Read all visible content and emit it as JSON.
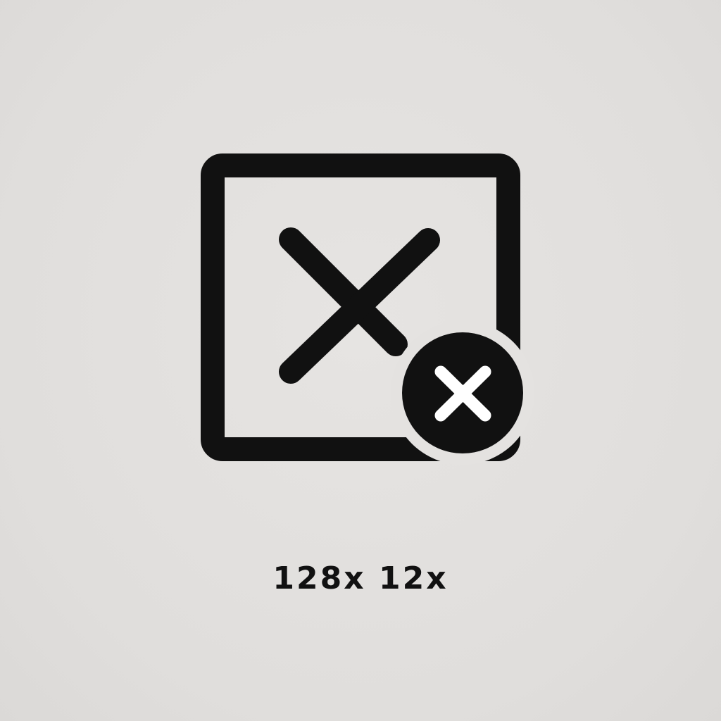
{
  "icon": {
    "name": "close-window-icon",
    "badge": "close-circle-icon",
    "stroke_color": "#111111",
    "background_color": "#e2e0de"
  },
  "caption": {
    "text": "128x 12x"
  }
}
